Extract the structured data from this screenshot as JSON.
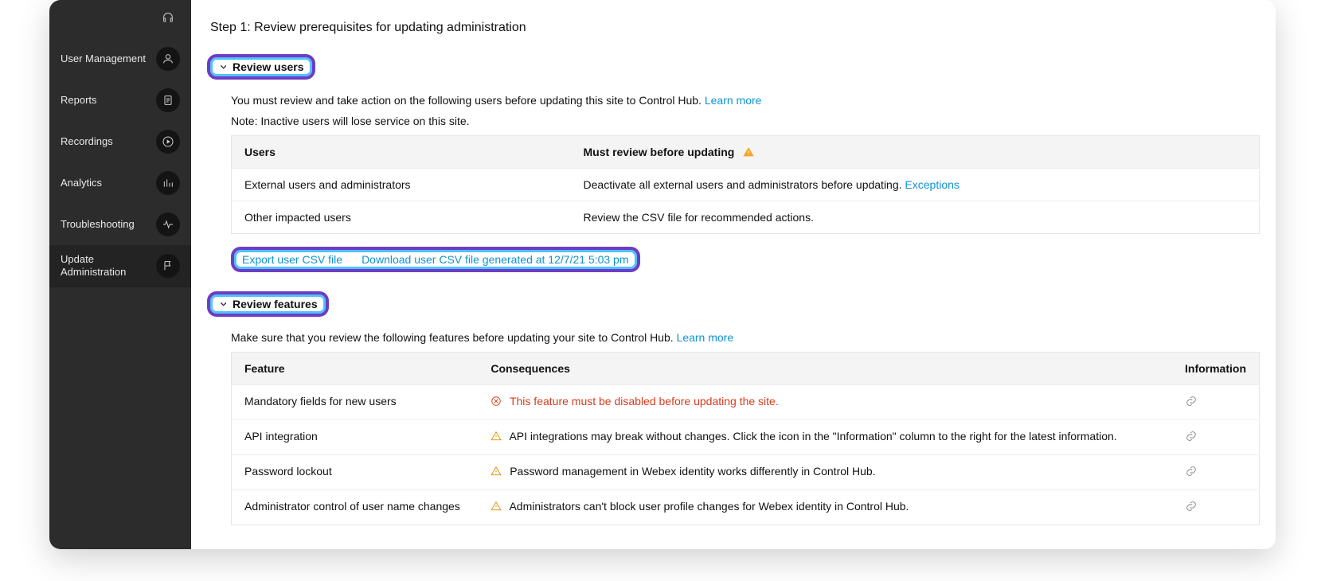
{
  "sidebar": {
    "items": [
      {
        "label": "",
        "icon": "headset"
      },
      {
        "label": "User Management",
        "icon": "user"
      },
      {
        "label": "Reports",
        "icon": "file"
      },
      {
        "label": "Recordings",
        "icon": "play"
      },
      {
        "label": "Analytics",
        "icon": "bar-chart"
      },
      {
        "label": "Troubleshooting",
        "icon": "pulse"
      },
      {
        "label": "Update Administration",
        "icon": "flag",
        "active": true
      }
    ]
  },
  "main": {
    "step_title": "Step 1: Review prerequisites for updating administration",
    "review_users": {
      "heading": "Review users",
      "description": "You must review and take action on the following users before updating this site to Control Hub.",
      "learn_more": "Learn more",
      "note": "Note: Inactive users will lose service on this site.",
      "table": {
        "headers": {
          "col1": "Users",
          "col2": "Must review before updating"
        },
        "rows": [
          {
            "users": "External users and administrators",
            "must_review": "Deactivate all external users and administrators before updating.",
            "link": "Exceptions"
          },
          {
            "users": "Other impacted users",
            "must_review": "Review the CSV file for recommended actions."
          }
        ]
      },
      "csv": {
        "export": "Export user CSV file",
        "download": "Download user CSV file generated at 12/7/21 5:03 pm"
      }
    },
    "review_features": {
      "heading": "Review features",
      "description": "Make sure that you review the following features before updating your site to Control Hub.",
      "learn_more": "Learn more",
      "table": {
        "headers": {
          "col1": "Feature",
          "col2": "Consequences",
          "col3": "Information"
        },
        "rows": [
          {
            "feature": "Mandatory fields for new users",
            "consequence": "This feature must be disabled before updating the site.",
            "level": "error"
          },
          {
            "feature": "API integration",
            "consequence": "API integrations may break without changes. Click the icon in the \"Information\" column to the right for the latest information.",
            "level": "warn"
          },
          {
            "feature": "Password lockout",
            "consequence": "Password management in Webex identity works differently in Control Hub.",
            "level": "warn"
          },
          {
            "feature": "Administrator control of user name changes",
            "consequence": "Administrators can't block user profile changes for Webex identity in Control Hub.",
            "level": "warn"
          }
        ]
      }
    }
  }
}
